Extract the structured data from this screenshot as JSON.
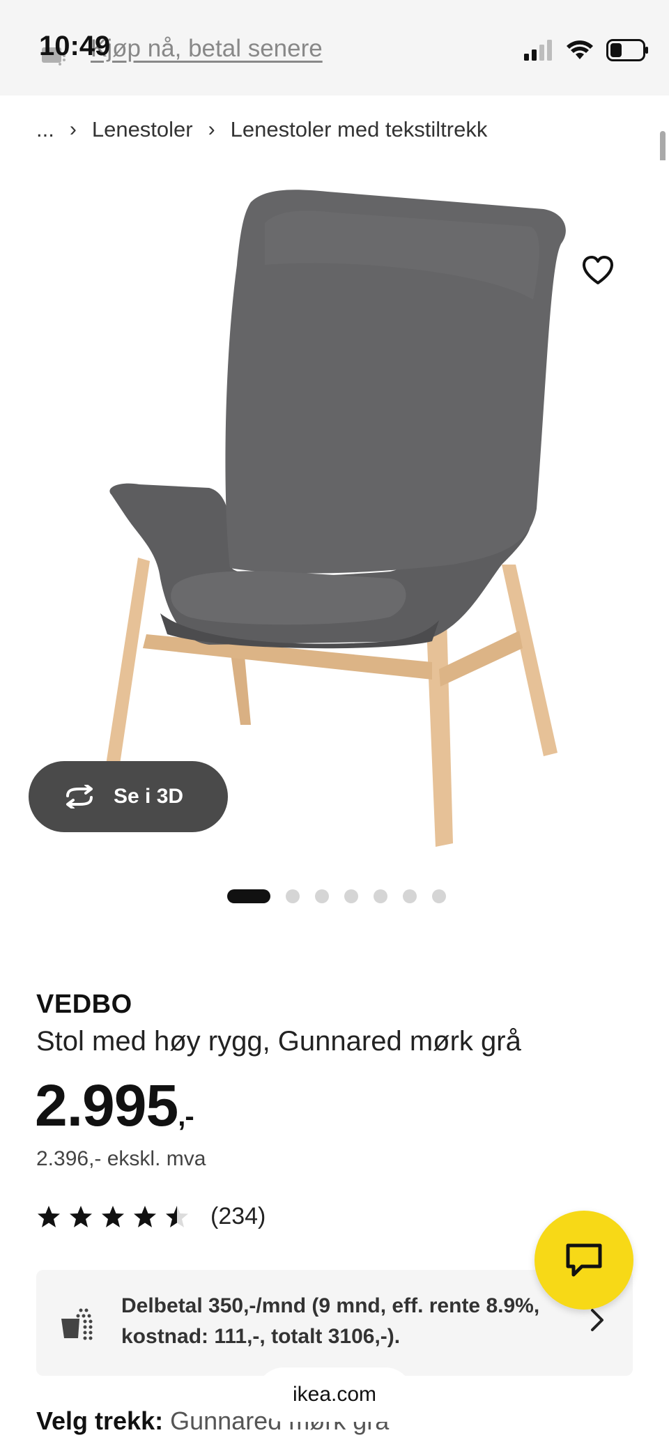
{
  "status_bar": {
    "time": "10:49",
    "promo_link": "Kjøp nå, betal senere"
  },
  "breadcrumb": {
    "ellipsis": "...",
    "items": [
      "Lenestoler",
      "Lenestoler med tekstiltrekk"
    ]
  },
  "gallery": {
    "view_3d_label": "Se i 3D",
    "pagination_count": 7,
    "active_index": 0
  },
  "product": {
    "brand": "VEDBO",
    "description": "Stol med høy rygg, Gunnared mørk grå",
    "price": "2.995",
    "price_suffix": ",-",
    "price_ex_vat": "2.396,- ekskl. mva",
    "rating": 4.5,
    "review_count": "(234)"
  },
  "financing": {
    "text": "Delbetal 350,-/mnd (9 mnd, eff. rente 8.9%, kostnad: 111,-, totalt 3106,-)."
  },
  "options": {
    "choose_label": "Velg trekk:",
    "choose_value": "Gunnared mørk grå"
  },
  "browser": {
    "url": "ikea.com"
  },
  "colors": {
    "chat_button": "#f7d917",
    "view_3d_bg": "#4a4a4a",
    "chair_fabric": "#5d5d5f",
    "chair_wood": "#e6c197"
  }
}
